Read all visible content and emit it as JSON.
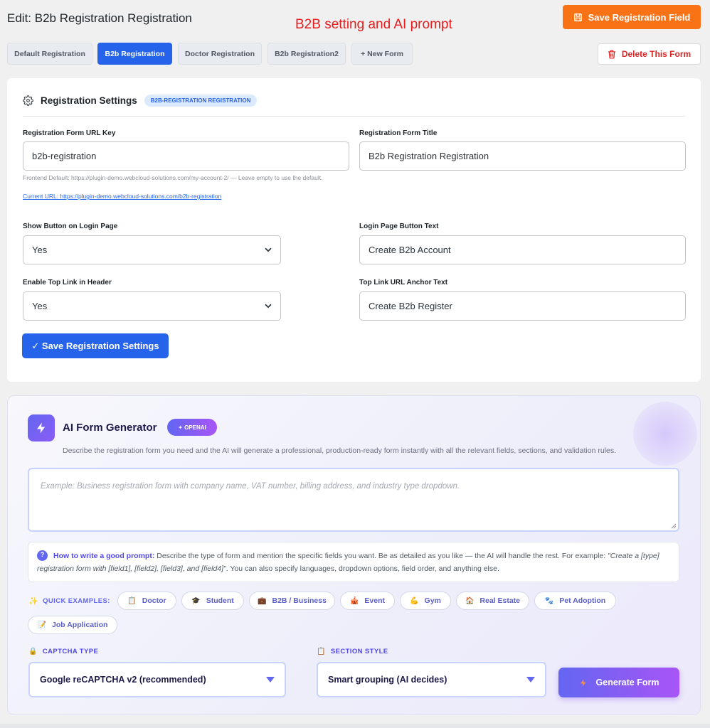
{
  "header": {
    "title": "Edit: B2b Registration Registration",
    "note": "B2B setting and AI prompt",
    "save_field_label": "Save Registration Field",
    "delete_label": "Delete This Form"
  },
  "tabs": [
    {
      "label": "Default Registration",
      "active": false
    },
    {
      "label": "B2b Registration",
      "active": true
    },
    {
      "label": "Doctor Registration",
      "active": false
    },
    {
      "label": "B2b Registration2",
      "active": false
    },
    {
      "label": "+ New Form",
      "active": false
    }
  ],
  "settings": {
    "title": "Registration Settings",
    "badge": "B2B-REGISTRATION REGISTRATION",
    "url_key_label": "Registration Form URL Key",
    "url_key_value": "b2b-registration",
    "form_title_label": "Registration Form Title",
    "form_title_value": "B2b Registration Registration",
    "help_text": "Frontend Default: https://plugin-demo.webcloud-solutions.com/my-account-2/ — Leave empty to use the default.",
    "current_url": "Current URL: https://plugin-demo.webcloud-solutions.com/b2b-registration",
    "show_button_label": "Show Button on Login Page",
    "show_button_value": "Yes",
    "login_button_text_label": "Login Page Button Text",
    "login_button_text_value": "Create B2b Account",
    "top_link_label": "Enable Top Link in Header",
    "top_link_value": "Yes",
    "anchor_text_label": "Top Link URL Anchor Text",
    "anchor_text_value": "Create B2b Register",
    "save_settings_label": "✓ Save Registration Settings"
  },
  "ai": {
    "title": "AI Form Generator",
    "badge": "✦ OPENAI",
    "description": "Describe the registration form you need and the AI will generate a professional, production-ready form instantly with all the relevant fields, sections, and validation rules.",
    "prompt_placeholder": "Example: Business registration form with company name, VAT number, billing address, and industry type dropdown.",
    "tip_heading": "How to write a good prompt:",
    "tip_body": " Describe the type of form and mention the specific fields you want. Be as detailed as you like — the AI will handle the rest. For example: ",
    "tip_example": "\"Create a [type] registration form with [field1], [field2], [field3], and [field4]\"",
    "tip_tail": ". You can also specify languages, dropdown options, field order, and anything else.",
    "quick_label": "QUICK EXAMPLES:",
    "quick_examples": [
      {
        "icon": "📋",
        "label": "Doctor"
      },
      {
        "icon": "🎓",
        "label": "Student"
      },
      {
        "icon": "💼",
        "label": "B2B / Business"
      },
      {
        "icon": "🎪",
        "label": "Event"
      },
      {
        "icon": "💪",
        "label": "Gym"
      },
      {
        "icon": "🏠",
        "label": "Real Estate"
      },
      {
        "icon": "🐾",
        "label": "Pet Adoption"
      },
      {
        "icon": "📝",
        "label": "Job Application"
      }
    ],
    "captcha_label": "CAPTCHA TYPE",
    "captcha_value": "Google reCAPTCHA v2 (recommended)",
    "section_label": "SECTION STYLE",
    "section_value": "Smart grouping (AI decides)",
    "generate_label": "Generate Form"
  },
  "colors": {
    "primary": "#2563eb",
    "orange": "#f97316",
    "danger": "#dc2626",
    "ai_accent": "#6366f1"
  }
}
